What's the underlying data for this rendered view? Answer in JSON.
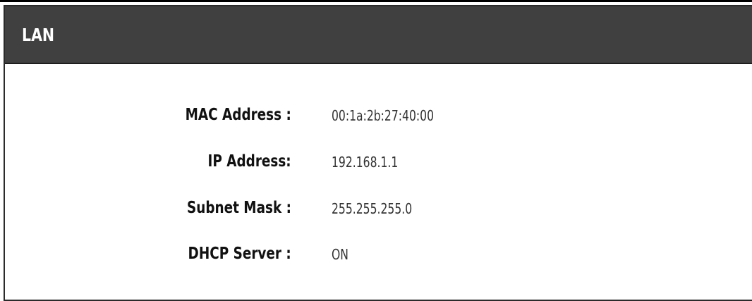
{
  "section": {
    "title": "LAN"
  },
  "fields": [
    {
      "label": "MAC Address :",
      "value": "00:1a:2b:27:40:00"
    },
    {
      "label": "IP Address:",
      "value": "192.168.1.1"
    },
    {
      "label": "Subnet Mask :",
      "value": "255.255.255.0"
    },
    {
      "label": "DHCP Server :",
      "value": "ON"
    }
  ],
  "colors": {
    "header_bg": "#404040",
    "header_text": "#ffffff",
    "label_text": "#111111",
    "value_text": "#333333"
  }
}
